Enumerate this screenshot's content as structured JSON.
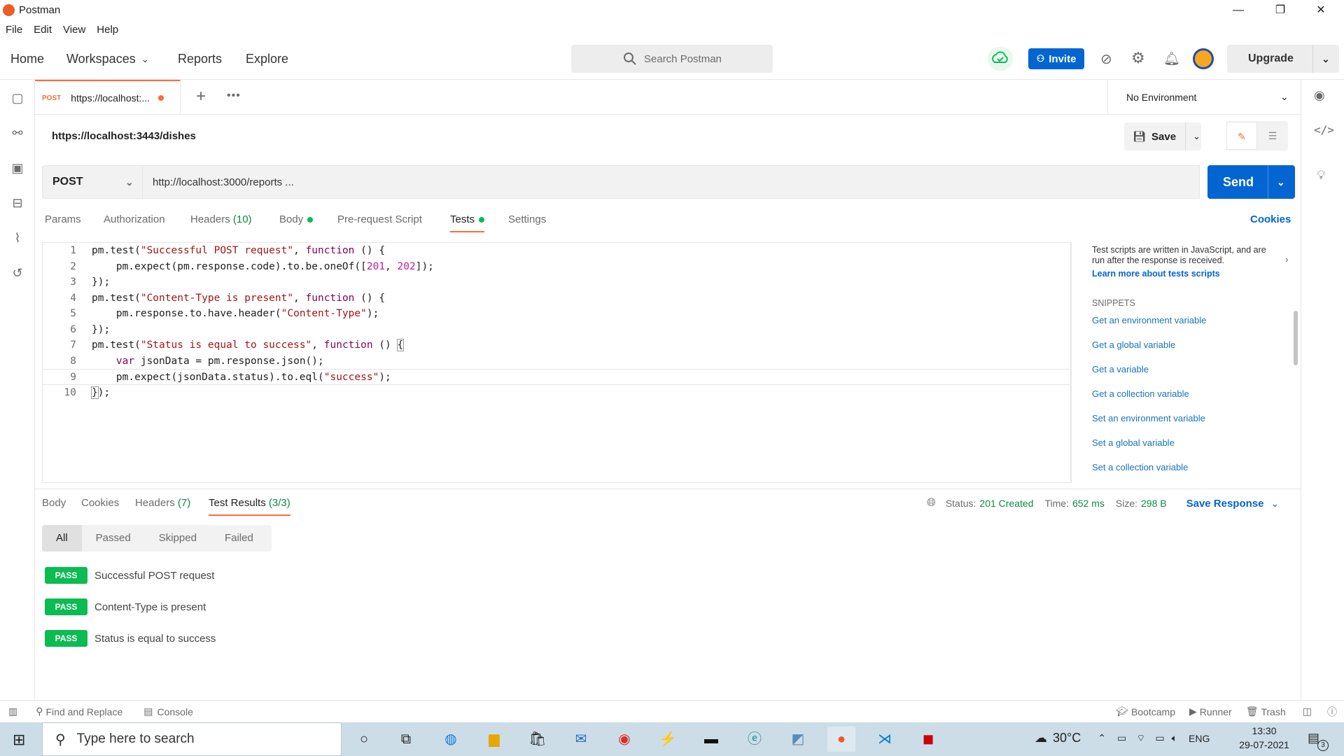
{
  "window": {
    "title": "Postman",
    "minimize": "—",
    "maximize": "❐",
    "close": "✕"
  },
  "menu": [
    "File",
    "Edit",
    "View",
    "Help"
  ],
  "nav": {
    "home": "Home",
    "workspaces": "Workspaces",
    "reports": "Reports",
    "explore": "Explore"
  },
  "search": {
    "placeholder": "Search Postman"
  },
  "header": {
    "invite": "Invite",
    "upgrade": "Upgrade"
  },
  "tab": {
    "method": "POST",
    "label": "https://localhost:..."
  },
  "environment": {
    "selected": "No Environment"
  },
  "request": {
    "name": "https://localhost:3443/dishes",
    "save": "Save",
    "method": "POST",
    "url": "http://localhost:3000/reports ...",
    "send": "Send"
  },
  "request_tabs": {
    "params": "Params",
    "authorization": "Authorization",
    "headers": "Headers",
    "headers_count": "(10)",
    "body": "Body",
    "prerequest": "Pre-request Script",
    "tests": "Tests",
    "settings": "Settings",
    "cookies": "Cookies"
  },
  "code": {
    "line_numbers": [
      "1",
      "2",
      "3",
      "4",
      "5",
      "6",
      "7",
      "8",
      "9",
      "10"
    ]
  },
  "snippets": {
    "info": "Test scripts are written in JavaScript, and are run after the response is received.",
    "learn_more": "Learn more about tests scripts",
    "heading": "SNIPPETS",
    "items": [
      "Get an environment variable",
      "Get a global variable",
      "Get a variable",
      "Get a collection variable",
      "Set an environment variable",
      "Set a global variable",
      "Set a collection variable"
    ]
  },
  "response": {
    "tabs": {
      "body": "Body",
      "cookies": "Cookies",
      "headers": "Headers",
      "headers_count": "(7)",
      "test_results": "Test Results",
      "test_results_count": "(3/3)"
    },
    "status_label": "Status:",
    "status_value": "201 Created",
    "time_label": "Time:",
    "time_value": "652 ms",
    "size_label": "Size:",
    "size_value": "298 B",
    "save_response": "Save Response",
    "filters": [
      "All",
      "Passed",
      "Skipped",
      "Failed"
    ],
    "results": [
      {
        "status": "PASS",
        "name": "Successful POST request"
      },
      {
        "status": "PASS",
        "name": "Content-Type is present"
      },
      {
        "status": "PASS",
        "name": "Status is equal to success"
      }
    ]
  },
  "footer": {
    "find_replace": "Find and Replace",
    "console": "Console",
    "bootcamp": "Bootcamp",
    "runner": "Runner",
    "trash": "Trash"
  },
  "taskbar": {
    "search": "Type here to search",
    "temperature": "30°C",
    "language": "ENG",
    "time": "13:30",
    "date": "29-07-2021",
    "notifications": "3"
  }
}
